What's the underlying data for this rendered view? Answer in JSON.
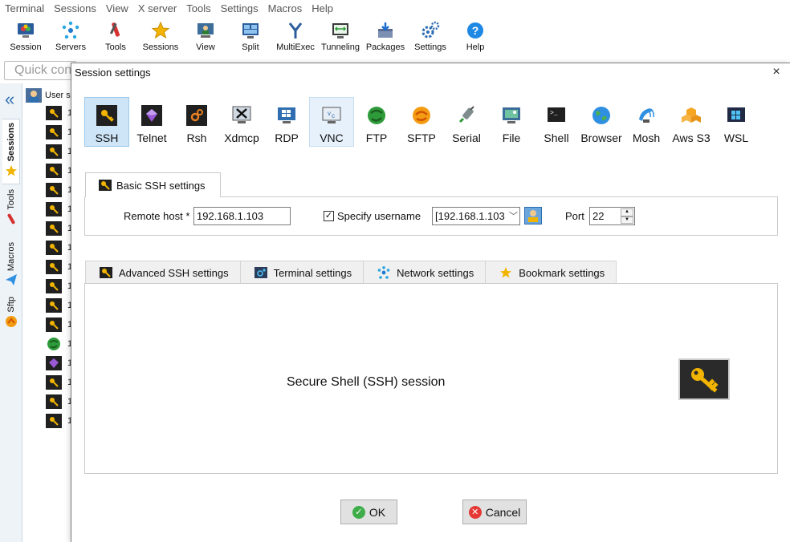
{
  "menu": [
    "Terminal",
    "Sessions",
    "View",
    "X server",
    "Tools",
    "Settings",
    "Macros",
    "Help"
  ],
  "toolbar": [
    {
      "label": "Session",
      "icon": "session-icon"
    },
    {
      "label": "Servers",
      "icon": "servers-icon"
    },
    {
      "label": "Tools",
      "icon": "tools-icon"
    },
    {
      "label": "Sessions",
      "icon": "star-icon"
    },
    {
      "label": "View",
      "icon": "view-icon"
    },
    {
      "label": "Split",
      "icon": "split-icon"
    },
    {
      "label": "MultiExec",
      "icon": "multiexec-icon"
    },
    {
      "label": "Tunneling",
      "icon": "tunneling-icon"
    },
    {
      "label": "Packages",
      "icon": "packages-icon"
    },
    {
      "label": "Settings",
      "icon": "settings-icon"
    },
    {
      "label": "Help",
      "icon": "help-icon"
    }
  ],
  "quick_connect": {
    "placeholder": "Quick con"
  },
  "sidebar": {
    "tabs": [
      "Sessions",
      "Tools",
      "Macros",
      "Sftp"
    ]
  },
  "session_tree": {
    "root_label": "User se",
    "item_prefix": "1",
    "items": [
      "ssh",
      "ssh",
      "ssh",
      "ssh",
      "ssh",
      "ssh",
      "ssh",
      "ssh",
      "ssh",
      "ssh",
      "ssh",
      "ssh",
      "ftp",
      "telnet",
      "ssh",
      "ssh",
      "ssh"
    ]
  },
  "dialog": {
    "title": "Session settings",
    "close": "×",
    "session_types": [
      {
        "label": "SSH",
        "icon": "ssh-key-icon",
        "state": "selected"
      },
      {
        "label": "Telnet",
        "icon": "telnet-icon"
      },
      {
        "label": "Rsh",
        "icon": "rsh-icon"
      },
      {
        "label": "Xdmcp",
        "icon": "xdmcp-icon"
      },
      {
        "label": "RDP",
        "icon": "rdp-icon"
      },
      {
        "label": "VNC",
        "icon": "vnc-icon",
        "state": "hover"
      },
      {
        "label": "FTP",
        "icon": "ftp-icon"
      },
      {
        "label": "SFTP",
        "icon": "sftp-icon"
      },
      {
        "label": "Serial",
        "icon": "serial-icon"
      },
      {
        "label": "File",
        "icon": "file-icon"
      },
      {
        "label": "Shell",
        "icon": "shell-icon"
      },
      {
        "label": "Browser",
        "icon": "browser-icon"
      },
      {
        "label": "Mosh",
        "icon": "mosh-icon"
      },
      {
        "label": "Aws S3",
        "icon": "aws-s3-icon"
      },
      {
        "label": "WSL",
        "icon": "wsl-icon"
      }
    ],
    "basic": {
      "tab_label": "Basic SSH settings",
      "remote_host_label": "Remote host *",
      "remote_host_value": "192.168.1.103",
      "specify_username_label": "Specify username",
      "specify_username_checked": true,
      "username_value": "[192.168.1.103",
      "port_label": "Port",
      "port_value": "22"
    },
    "advanced_tabs": [
      {
        "label": "Advanced SSH settings",
        "icon": "key-icon"
      },
      {
        "label": "Terminal settings",
        "icon": "terminal-icon"
      },
      {
        "label": "Network settings",
        "icon": "network-icon"
      },
      {
        "label": "Bookmark settings",
        "icon": "star-icon"
      }
    ],
    "description": "Secure Shell (SSH) session",
    "ok_label": "OK",
    "cancel_label": "Cancel"
  },
  "colors": {
    "accent": "#2f6fb0",
    "selected_bg": "#cde5f7",
    "key_gold": "#f2b400"
  }
}
